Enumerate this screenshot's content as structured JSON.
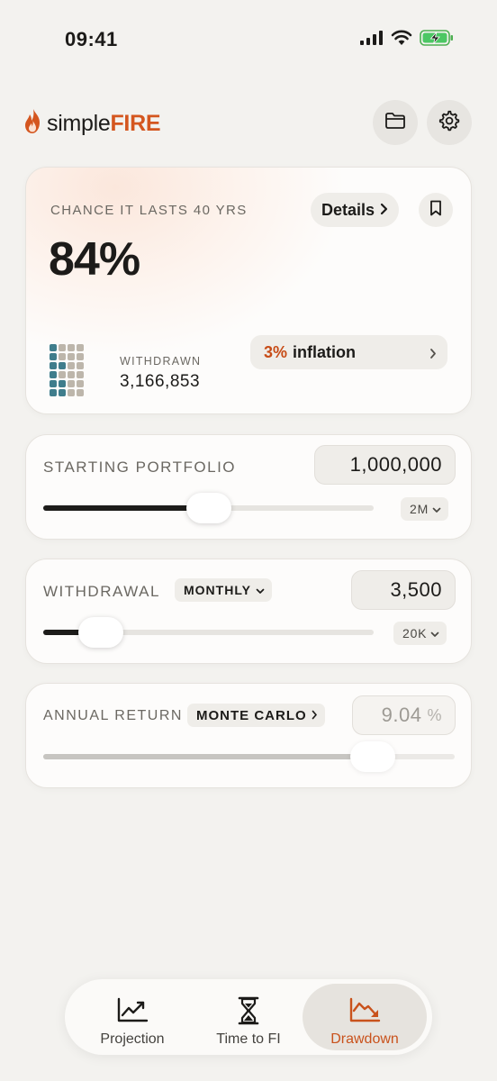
{
  "status_bar": {
    "time": "09:41"
  },
  "app": {
    "name_prefix": "simple",
    "name_accent": "FIRE",
    "accent_color": "#d4561f"
  },
  "header": {
    "icons": [
      "folder-icon",
      "gear-icon"
    ]
  },
  "summary": {
    "label": "CHANCE IT LASTS 40 YRS",
    "details_label": "Details",
    "percentage": "84%",
    "withdrawn_label": "WITHDRAWN",
    "withdrawn_value": "3,166,853",
    "inflation_value": "3%",
    "inflation_label": "inflation"
  },
  "starting_portfolio": {
    "label": "STARTING PORTFOLIO",
    "value": "1,000,000",
    "slider_fraction": 0.5,
    "max_label": "2M"
  },
  "withdrawal": {
    "label": "WITHDRAWAL",
    "frequency": "MONTHLY",
    "value": "3,500",
    "slider_fraction": 0.175,
    "max_label": "20K"
  },
  "annual_return": {
    "label": "ANNUAL RETURN",
    "mode": "MONTE CARLO",
    "value": "9.04",
    "unit": "%",
    "slider_fraction": 0.8
  },
  "tabs": [
    {
      "label": "Projection",
      "icon": "line-chart-icon",
      "active": false
    },
    {
      "label": "Time to FI",
      "icon": "hourglass-icon",
      "active": false
    },
    {
      "label": "Drawdown",
      "icon": "drawdown-chart-icon",
      "active": true
    }
  ],
  "colors": {
    "accent": "#c9521c",
    "teal": "#3f7d8c",
    "grey_block": "#bdb6ab",
    "background": "#f3f2ef"
  }
}
